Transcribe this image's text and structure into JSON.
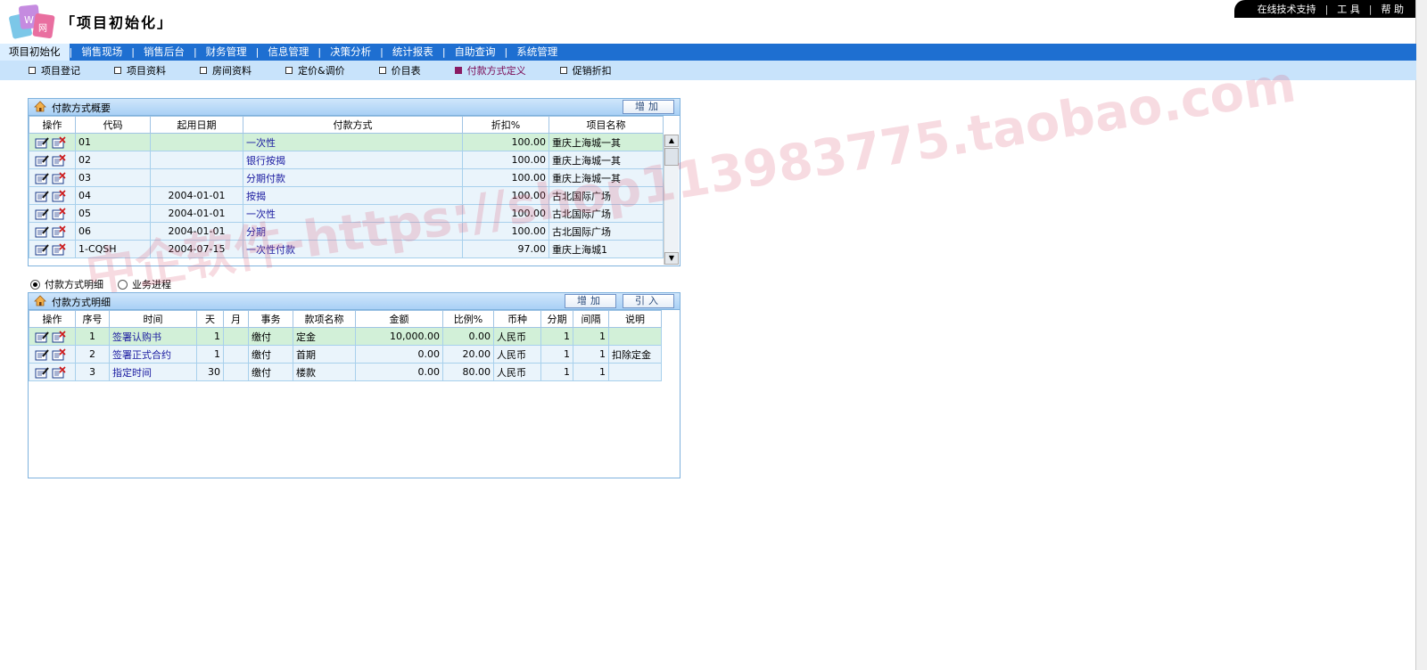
{
  "app": {
    "title": "项目初始化"
  },
  "toplinks": [
    "在线技术支持",
    "工 具",
    "帮 助"
  ],
  "main_nav": [
    "项目初始化",
    "销售现场",
    "销售后台",
    "财务管理",
    "信息管理",
    "决策分析",
    "统计报表",
    "自助查询",
    "系统管理"
  ],
  "sub_nav": [
    "项目登记",
    "项目资料",
    "房间资料",
    "定价&调价",
    "价目表",
    "付款方式定义",
    "促销折扣"
  ],
  "summary": {
    "title": "付款方式概要",
    "add_label": "增加",
    "columns": [
      "操作",
      "代码",
      "起用日期",
      "付款方式",
      "折扣%",
      "项目名称"
    ],
    "rows": [
      {
        "code": "01",
        "date": "",
        "method": "一次性",
        "discount": "100.00",
        "project": "重庆上海城一其"
      },
      {
        "code": "02",
        "date": "",
        "method": "银行按揭",
        "discount": "100.00",
        "project": "重庆上海城一其"
      },
      {
        "code": "03",
        "date": "",
        "method": "分期付款",
        "discount": "100.00",
        "project": "重庆上海城一其"
      },
      {
        "code": "04",
        "date": "2004-01-01",
        "method": "按揭",
        "discount": "100.00",
        "project": "古北国际广场"
      },
      {
        "code": "05",
        "date": "2004-01-01",
        "method": "一次性",
        "discount": "100.00",
        "project": "古北国际广场"
      },
      {
        "code": "06",
        "date": "2004-01-01",
        "method": "分期",
        "discount": "100.00",
        "project": "古北国际广场"
      },
      {
        "code": "1-CQSH",
        "date": "2004-07-15",
        "method": "一次性付款",
        "discount": "97.00",
        "project": "重庆上海城1"
      }
    ]
  },
  "radios": [
    {
      "label": "付款方式明细",
      "checked": true
    },
    {
      "label": "业务进程",
      "checked": false
    }
  ],
  "detail": {
    "title": "付款方式明细",
    "add_label": "增加",
    "import_label": "引入",
    "columns": [
      "操作",
      "序号",
      "时间",
      "天",
      "月",
      "事务",
      "款项名称",
      "金额",
      "比例%",
      "币种",
      "分期",
      "间隔",
      "说明"
    ],
    "rows": [
      {
        "seq": "1",
        "time": "签署认购书",
        "day": "1",
        "month": "",
        "affair": "缴付",
        "item": "定金",
        "amount": "10,000.00",
        "ratio": "0.00",
        "currency": "人民币",
        "stage": "1",
        "interval": "1",
        "note": ""
      },
      {
        "seq": "2",
        "time": "签署正式合约",
        "day": "1",
        "month": "",
        "affair": "缴付",
        "item": "首期",
        "amount": "0.00",
        "ratio": "20.00",
        "currency": "人民币",
        "stage": "1",
        "interval": "1",
        "note": "扣除定金"
      },
      {
        "seq": "3",
        "time": "指定时间",
        "day": "30",
        "month": "",
        "affair": "缴付",
        "item": "楼款",
        "amount": "0.00",
        "ratio": "80.00",
        "currency": "人民币",
        "stage": "1",
        "interval": "1",
        "note": ""
      }
    ]
  },
  "watermark": "中企软件-https://shop113983775.taobao.com",
  "colors": {
    "nav_bg": "#1e6fd1",
    "subnav_bg": "#c8e3fb",
    "selected_row": "#d2f0d8",
    "row": "#eaf4fb",
    "link": "#1a1aa0"
  }
}
